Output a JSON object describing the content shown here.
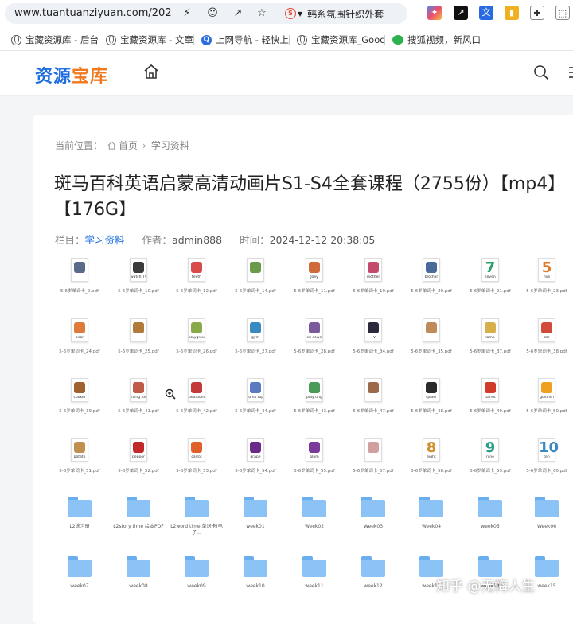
{
  "browser": {
    "url": "www.tuantuanziyuan.com/202",
    "tab_search_text": "韩系氛围针织外套"
  },
  "bookmarks": [
    {
      "label": "宝藏资源库 - 后台",
      "icon": "globe-icon"
    },
    {
      "label": "宝藏资源库 - 文章",
      "icon": "globe-icon"
    },
    {
      "label": "上网导航 - 轻快上",
      "icon": "q-icon"
    },
    {
      "label": "宝藏资源库_Good",
      "icon": "globe-icon"
    },
    {
      "label": "搜狐视频，新风口",
      "icon": "wechat-icon"
    }
  ],
  "site": {
    "logo": [
      "资",
      "源",
      "宝",
      "库"
    ]
  },
  "breadcrumb": {
    "prefix": "当前位置：",
    "home": "首页",
    "section": "学习资料"
  },
  "article": {
    "title": "斑马百科英语启蒙高清动画片S1-S4全套课程（2755份）【mp4】【176G】",
    "category_label": "栏目：",
    "category": "学习资料",
    "author_label": "作者：",
    "author": "admin888",
    "time_label": "时间：",
    "time": "2024-12-12 20:38:05"
  },
  "files": [
    {
      "cap": "",
      "name": "5-6岁单词卡_9.pdf",
      "color": "#5a6b8a"
    },
    {
      "cap": "watch TV",
      "name": "5-6岁单词卡_10.pdf",
      "color": "#3b3b3b"
    },
    {
      "cap": "teeth",
      "name": "5-6岁单词卡_12.pdf",
      "color": "#d94b4b"
    },
    {
      "cap": "",
      "name": "5-6岁单词卡_14.pdf",
      "color": "#6a9a4a"
    },
    {
      "cap": "Joey",
      "name": "5-6岁单词卡_11.pdf",
      "color": "#d06a3a"
    },
    {
      "cap": "mother",
      "name": "5-6岁单词卡_19.pdf",
      "color": "#c24a6a"
    },
    {
      "cap": "brother",
      "name": "5-6岁单词卡_20.pdf",
      "color": "#4a6a9a"
    },
    {
      "num": "7",
      "cap": "seven",
      "name": "5-6岁单词卡_21.pdf",
      "color": "#2aa06a"
    },
    {
      "num": "5",
      "cap": "five",
      "name": "5-6岁单词卡_23.pdf",
      "color": "#e07a2a"
    },
    {
      "cap": "bear",
      "name": "5-6岁单词卡_24.pdf",
      "color": "#e07a3a"
    },
    {
      "cap": "",
      "name": "5-6岁单词卡_25.pdf",
      "color": "#b07a3a"
    },
    {
      "cap": "playground",
      "name": "5-6岁单词卡_26.pdf",
      "color": "#8aaa4a"
    },
    {
      "cap": "gym",
      "name": "5-6岁单词卡_27.pdf",
      "color": "#3a8ac2"
    },
    {
      "cap": "sit down",
      "name": "5-6岁单词卡_28.pdf",
      "color": "#7a5a9a"
    },
    {
      "cap": "TV",
      "name": "5-6岁单词卡_34.pdf",
      "color": "#2a2a3a"
    },
    {
      "cap": "",
      "name": "5-6岁单词卡_35.pdf",
      "color": "#c08a5a"
    },
    {
      "cap": "lamp",
      "name": "5-6岁单词卡_37.pdf",
      "color": "#d8b04a"
    },
    {
      "cap": "car",
      "name": "5-6岁单词卡_38.pdf",
      "color": "#d24a3a"
    },
    {
      "cap": "cooker",
      "name": "5-6岁单词卡_39.pdf",
      "color": "#a06030"
    },
    {
      "cap": "living room",
      "name": "5-6岁单词卡_41.pdf",
      "color": "#c25a4a"
    },
    {
      "cap": "bedroom",
      "name": "5-6岁单词卡_42.pdf",
      "color": "#c23a3a"
    },
    {
      "cap": "jump rope",
      "name": "5-6岁单词卡_44.pdf",
      "color": "#5a7ac2"
    },
    {
      "cap": "play ting",
      "name": "5-6岁单词卡_43.pdf",
      "color": "#4a9a5a"
    },
    {
      "cap": "",
      "name": "5-6岁单词卡_47.pdf",
      "color": "#9a6a4a"
    },
    {
      "cap": "spider",
      "name": "5-6岁单词卡_48.pdf",
      "color": "#2a2a2a"
    },
    {
      "cap": "parrot",
      "name": "5-6岁单词卡_49.pdf",
      "color": "#d23a2a"
    },
    {
      "cap": "goldfish",
      "name": "5-6岁单词卡_50.pdf",
      "color": "#f0a020"
    },
    {
      "cap": "potato",
      "name": "5-6岁单词卡_51.pdf",
      "color": "#c09050"
    },
    {
      "cap": "pepper",
      "name": "5-6岁单词卡_52.pdf",
      "color": "#c22a2a"
    },
    {
      "cap": "carrot",
      "name": "5-6岁单词卡_53.pdf",
      "color": "#e0602a"
    },
    {
      "cap": "grape",
      "name": "5-6岁单词卡_54.pdf",
      "color": "#6a2a8a"
    },
    {
      "cap": "plum",
      "name": "5-6岁单词卡_55.pdf",
      "color": "#7a3a9a"
    },
    {
      "cap": "",
      "name": "5-6岁单词卡_57.pdf",
      "color": "#d0a0a0"
    },
    {
      "num": "8",
      "cap": "eight",
      "name": "5-6岁单词卡_58.pdf",
      "color": "#d0902a"
    },
    {
      "num": "9",
      "cap": "nine",
      "name": "5-6岁单词卡_59.pdf",
      "color": "#2aa08a"
    },
    {
      "num": "10",
      "cap": "ten",
      "name": "5-6岁单词卡_60.pdf",
      "color": "#3a8ac2"
    }
  ],
  "folders": [
    "L2练习册",
    "L2story time 绘本PDF",
    "L2word time 单词卡(电子...",
    "week01",
    "Week02",
    "Week03",
    "Week04",
    "week05",
    "Week06",
    "week07",
    "week08",
    "week09",
    "week10",
    "week11",
    "week12",
    "week13",
    "week14",
    "week15"
  ],
  "watermark": "知乎 @无悔人生"
}
